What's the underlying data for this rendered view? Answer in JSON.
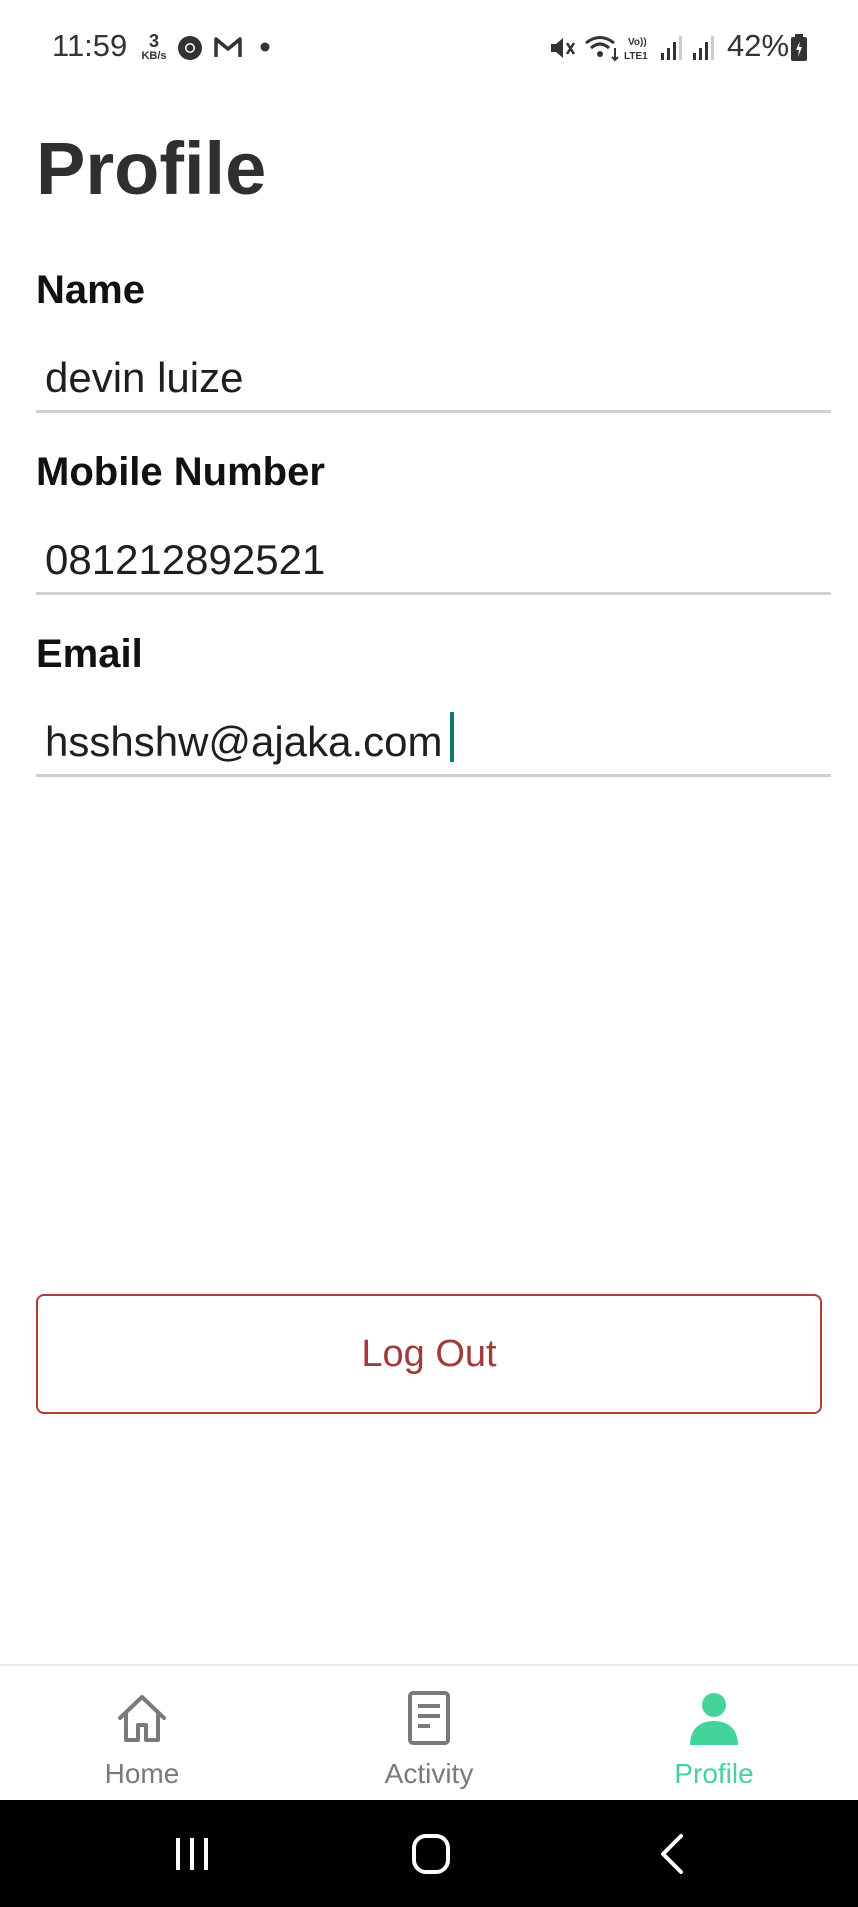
{
  "status_bar": {
    "time": "11:59",
    "net_speed_value": "3",
    "net_speed_unit": "KB/s",
    "battery": "42%",
    "icons_left": [
      "chrome-icon",
      "gmail-icon",
      "dot-icon"
    ],
    "icons_right": [
      "mute-icon",
      "wifi-icon",
      "volte-icon",
      "signal-icon",
      "signal-icon",
      "battery-icon"
    ]
  },
  "page": {
    "title": "Profile"
  },
  "form": {
    "name_label": "Name",
    "name_value": "devin luize",
    "mobile_label": "Mobile Number",
    "mobile_value": "081212892521",
    "email_label": "Email",
    "email_value": "hsshshw@ajaka.com"
  },
  "actions": {
    "logout_label": "Log Out"
  },
  "bottom_nav": {
    "items": [
      {
        "label": "Home",
        "icon": "home-icon",
        "active": false
      },
      {
        "label": "Activity",
        "icon": "document-icon",
        "active": false
      },
      {
        "label": "Profile",
        "icon": "person-icon",
        "active": true
      }
    ]
  },
  "colors": {
    "accent": "#44d39b",
    "logout": "#b23b3b",
    "caret": "#0f7a6e",
    "inactive_nav": "#7a7a7a"
  }
}
